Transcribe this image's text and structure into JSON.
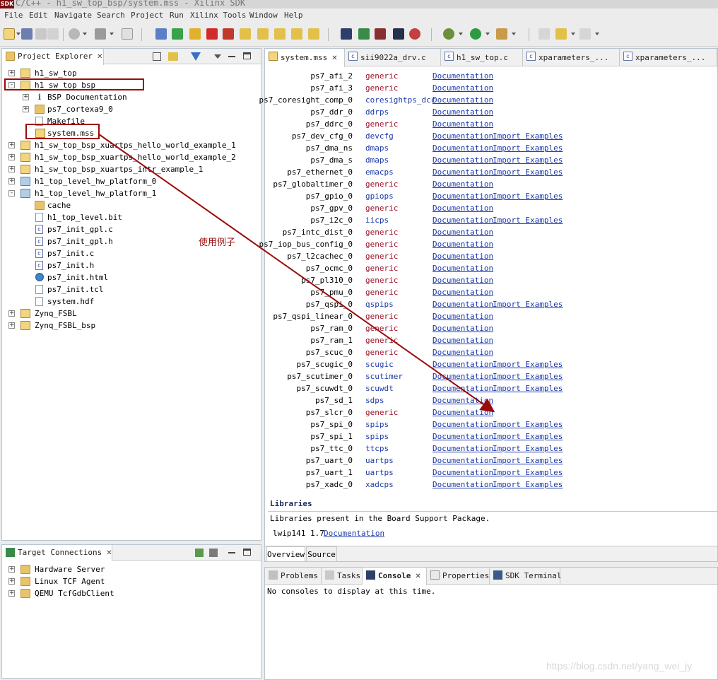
{
  "window": {
    "title": "C/C++ - h1_sw_top_bsp/system.mss - Xilinx SDK",
    "logo_text": "SDK"
  },
  "menu": [
    "File",
    "Edit",
    "Navigate",
    "Search",
    "Project",
    "Run",
    "Xilinx Tools",
    "Window",
    "Help"
  ],
  "project_explorer": {
    "title": "Project Explorer",
    "items": [
      {
        "label": "h1_sw_top",
        "toggle": "+",
        "icon": "project-icon"
      },
      {
        "label": "h1_sw_top_bsp",
        "toggle": "-",
        "icon": "bsp-project-icon"
      },
      {
        "label": "BSP Documentation",
        "toggle": "+",
        "icon": "info-icon"
      },
      {
        "label": "ps7_cortexa9_0",
        "toggle": "+",
        "icon": "folder-icon"
      },
      {
        "label": "Makefile",
        "toggle": "",
        "icon": "file-icon"
      },
      {
        "label": "system.mss",
        "toggle": "",
        "icon": "mss-file-icon"
      },
      {
        "label": "h1_sw_top_bsp_xuartps_hello_world_example_1",
        "toggle": "+",
        "icon": "project-icon"
      },
      {
        "label": "h1_sw_top_bsp_xuartps_hello_world_example_2",
        "toggle": "+",
        "icon": "project-icon"
      },
      {
        "label": "h1_sw_top_bsp_xuartps_intr_example_1",
        "toggle": "+",
        "icon": "project-icon"
      },
      {
        "label": "h1_top_level_hw_platform_0",
        "toggle": "+",
        "icon": "hw-platform-icon"
      },
      {
        "label": "h1_top_level_hw_platform_1",
        "toggle": "-",
        "icon": "hw-platform-icon"
      },
      {
        "label": "cache",
        "toggle": "",
        "icon": "folder-icon"
      },
      {
        "label": "h1_top_level.bit",
        "toggle": "",
        "icon": "file-icon"
      },
      {
        "label": "ps7_init_gpl.c",
        "toggle": "",
        "icon": "c-file-icon"
      },
      {
        "label": "ps7_init_gpl.h",
        "toggle": "",
        "icon": "h-file-icon"
      },
      {
        "label": "ps7_init.c",
        "toggle": "",
        "icon": "c-file-icon"
      },
      {
        "label": "ps7_init.h",
        "toggle": "",
        "icon": "h-file-icon"
      },
      {
        "label": "ps7_init.html",
        "toggle": "",
        "icon": "globe-icon"
      },
      {
        "label": "ps7_init.tcl",
        "toggle": "",
        "icon": "file-icon"
      },
      {
        "label": "system.hdf",
        "toggle": "",
        "icon": "file-icon"
      },
      {
        "label": "Zynq_FSBL",
        "toggle": "+",
        "icon": "project-icon"
      },
      {
        "label": "Zynq_FSBL_bsp",
        "toggle": "+",
        "icon": "bsp-project-icon"
      }
    ]
  },
  "annotation": {
    "label": "使用例子"
  },
  "target_connections": {
    "title": "Target Connections",
    "items": [
      "Hardware Server",
      "Linux TCF Agent",
      "QEMU TcfGdbClient"
    ]
  },
  "editor": {
    "tabs": [
      "system.mss",
      "sii9022a_drv.c",
      "h1_sw_top.c",
      "xparameters_...",
      "xparameters_..."
    ],
    "peripherals": [
      {
        "name": "ps7_afi_2",
        "driver": "generic",
        "doc": "Documentation",
        "import": ""
      },
      {
        "name": "ps7_afi_3",
        "driver": "generic",
        "doc": "Documentation",
        "import": ""
      },
      {
        "name": "ps7_coresight_comp_0",
        "driver": "coresightps_dcc",
        "doc": "Documentation",
        "import": ""
      },
      {
        "name": "ps7_ddr_0",
        "driver": "ddrps",
        "doc": "Documentation",
        "import": ""
      },
      {
        "name": "ps7_ddrc_0",
        "driver": "generic",
        "doc": "Documentation",
        "import": ""
      },
      {
        "name": "ps7_dev_cfg_0",
        "driver": "devcfg",
        "doc": "Documentation",
        "import": "Import Examples"
      },
      {
        "name": "ps7_dma_ns",
        "driver": "dmaps",
        "doc": "Documentation",
        "import": "Import Examples"
      },
      {
        "name": "ps7_dma_s",
        "driver": "dmaps",
        "doc": "Documentation",
        "import": "Import Examples"
      },
      {
        "name": "ps7_ethernet_0",
        "driver": "emacps",
        "doc": "Documentation",
        "import": "Import Examples"
      },
      {
        "name": "ps7_globaltimer_0",
        "driver": "generic",
        "doc": "Documentation",
        "import": ""
      },
      {
        "name": "ps7_gpio_0",
        "driver": "gpiops",
        "doc": "Documentation",
        "import": "Import Examples"
      },
      {
        "name": "ps7_gpv_0",
        "driver": "generic",
        "doc": "Documentation",
        "import": ""
      },
      {
        "name": "ps7_i2c_0",
        "driver": "iicps",
        "doc": "Documentation",
        "import": "Import Examples"
      },
      {
        "name": "ps7_intc_dist_0",
        "driver": "generic",
        "doc": "Documentation",
        "import": ""
      },
      {
        "name": "ps7_iop_bus_config_0",
        "driver": "generic",
        "doc": "Documentation",
        "import": ""
      },
      {
        "name": "ps7_l2cachec_0",
        "driver": "generic",
        "doc": "Documentation",
        "import": ""
      },
      {
        "name": "ps7_ocmc_0",
        "driver": "generic",
        "doc": "Documentation",
        "import": ""
      },
      {
        "name": "ps7_pl310_0",
        "driver": "generic",
        "doc": "Documentation",
        "import": ""
      },
      {
        "name": "ps7_pmu_0",
        "driver": "generic",
        "doc": "Documentation",
        "import": ""
      },
      {
        "name": "ps7_qspi_0",
        "driver": "qspips",
        "doc": "Documentation",
        "import": "Import Examples"
      },
      {
        "name": "ps7_qspi_linear_0",
        "driver": "generic",
        "doc": "Documentation",
        "import": ""
      },
      {
        "name": "ps7_ram_0",
        "driver": "generic",
        "doc": "Documentation",
        "import": ""
      },
      {
        "name": "ps7_ram_1",
        "driver": "generic",
        "doc": "Documentation",
        "import": ""
      },
      {
        "name": "ps7_scuc_0",
        "driver": "generic",
        "doc": "Documentation",
        "import": ""
      },
      {
        "name": "ps7_scugic_0",
        "driver": "scugic",
        "doc": "Documentation",
        "import": "Import Examples"
      },
      {
        "name": "ps7_scutimer_0",
        "driver": "scutimer",
        "doc": "Documentation",
        "import": "Import Examples"
      },
      {
        "name": "ps7_scuwdt_0",
        "driver": "scuwdt",
        "doc": "Documentation",
        "import": "Import Examples"
      },
      {
        "name": "ps7_sd_1",
        "driver": "sdps",
        "doc": "Documentation",
        "import": ""
      },
      {
        "name": "ps7_slcr_0",
        "driver": "generic",
        "doc": "Documentation",
        "import": ""
      },
      {
        "name": "ps7_spi_0",
        "driver": "spips",
        "doc": "Documentation",
        "import": "Import Examples"
      },
      {
        "name": "ps7_spi_1",
        "driver": "spips",
        "doc": "Documentation",
        "import": "Import Examples"
      },
      {
        "name": "ps7_ttc_0",
        "driver": "ttcps",
        "doc": "Documentation",
        "import": "Import Examples"
      },
      {
        "name": "ps7_uart_0",
        "driver": "uartps",
        "doc": "Documentation",
        "import": "Import Examples"
      },
      {
        "name": "ps7_uart_1",
        "driver": "uartps",
        "doc": "Documentation",
        "import": "Import Examples"
      },
      {
        "name": "ps7_xadc_0",
        "driver": "xadcps",
        "doc": "Documentation",
        "import": "Import Examples"
      }
    ],
    "libraries": {
      "heading": "Libraries",
      "description": "Libraries present in the Board Support Package.",
      "lib_name": "lwip141 1.7",
      "doc": "Documentation"
    },
    "bottom_tabs": [
      "Overview",
      "Source"
    ]
  },
  "console": {
    "tabs": [
      "Problems",
      "Tasks",
      "Console",
      "Properties",
      "SDK Terminal"
    ],
    "active_tab": "Console",
    "message": "No consoles to display at this time."
  },
  "watermark": "https://blog.csdn.net/yang_wei_jy",
  "colors": {
    "generic_driver": "#a0102a",
    "link": "#1c3aa8",
    "annotation": "#9b0b0b"
  }
}
